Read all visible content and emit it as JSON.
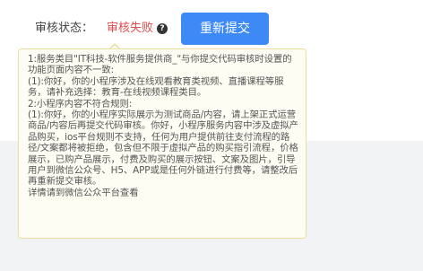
{
  "status": {
    "label": "审核状态：",
    "value": "审核失败",
    "help_icon": "question-circle-icon",
    "value_color": "#e24b4b"
  },
  "actions": {
    "resubmit_label": "重新提交",
    "accent_color": "#3d8af7"
  },
  "tooltip": {
    "message": "1:服务类目\"IT科技-软件服务提供商_\"与你提交代码审核时设置的功能页面内容不一致:\n(1):你好，你的小程序涉及在线观看教育类视频、直播课程等服务，请补充选择：教育-在线视频课程类目。\n2:小程序内容不符合规则:\n(1):你好，你的小程序实际展示为测试商品/内容，请上架正式运营商品/内容后再提交代码审核。你好，小程序服务内容中涉及虚拟产品购买，ios平台规则不支持，任何为用户提供前往支付流程的路径/文案都将被拒绝，包含但不限于虚拟产品的购买指引流程，价格展示，已购产品展示，付费及购买的展示按钮、文案及图片，引导用户到微信公众号、H5、APP或是任何外链进行付费等，请整改后再重新提交审核。\n详情请到微信公众平台查看"
  }
}
